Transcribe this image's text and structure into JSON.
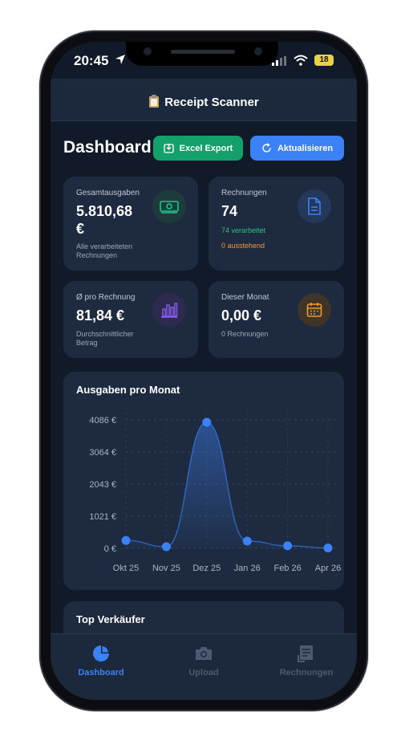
{
  "status": {
    "time": "20:45",
    "battery": "18"
  },
  "header": {
    "title": "Receipt Scanner"
  },
  "dashboard": {
    "title": "Dashboard",
    "excel_label": "Excel Export",
    "refresh_label": "Aktualisieren"
  },
  "cards": {
    "total": {
      "label": "Gesamtausgaben",
      "value_line1": "5.810,68",
      "value_line2": "€",
      "sub_line1": "Alle verarbeiteten",
      "sub_line2": "Rechnungen"
    },
    "invoices": {
      "label": "Rechnungen",
      "value": "74",
      "processed": "74 verarbeitet",
      "pending": "0 ausstehend"
    },
    "average": {
      "label": "Ø pro Rechnung",
      "value": "81,84 €",
      "sub_line1": "Durchschnittlicher",
      "sub_line2": "Betrag"
    },
    "month": {
      "label": "Dieser Monat",
      "value": "0,00 €",
      "sub": "0 Rechnungen"
    }
  },
  "chart_section": {
    "title": "Ausgaben pro Monat"
  },
  "chart_data": {
    "type": "area",
    "title": "Ausgaben pro Monat",
    "categories": [
      "Okt 25",
      "Nov 25",
      "Dez 25",
      "Jan 26",
      "Feb 26",
      "Apr 26"
    ],
    "values": [
      250,
      50,
      4010,
      230,
      80,
      10
    ],
    "yticks": [
      "0 €",
      "1021 €",
      "2043 €",
      "3064 €",
      "4086 €"
    ],
    "ylim": [
      0,
      4086
    ],
    "grid": true,
    "color": "#3b82f6"
  },
  "top_sellers": {
    "title": "Top Verkäufer"
  },
  "tabs": [
    {
      "label": "Dashboard"
    },
    {
      "label": "Upload"
    },
    {
      "label": "Rechnungen"
    }
  ],
  "colors": {
    "accent": "#3b82f6",
    "success": "#14a06a",
    "warning": "#f29a2e",
    "card": "#1e2a3f",
    "bg": "#111a29"
  }
}
